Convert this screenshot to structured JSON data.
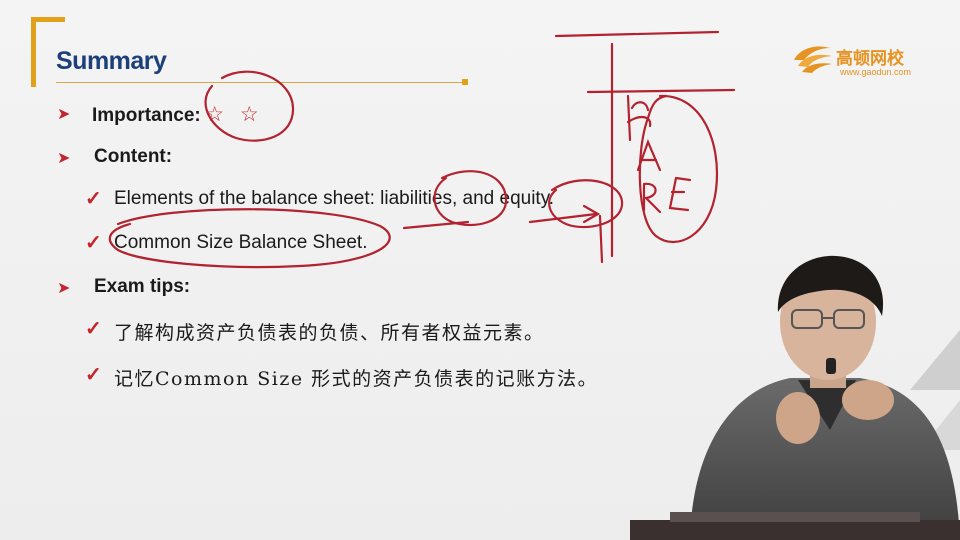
{
  "slide": {
    "title": "Summary",
    "logo": {
      "name": "高顿网校",
      "url": "www.gaodun.com"
    },
    "bullets": {
      "importance_label": "Importance:",
      "importance_stars": "☆ ☆",
      "content_label": "Content:",
      "content_items": [
        "Elements of the balance sheet: liabilities, and equity.",
        "Common Size Balance Sheet."
      ],
      "exam_label": "Exam tips:",
      "exam_items": [
        "了解构成资产负债表的负债、所有者权益元素。",
        "记忆Common Size 形式的资产负债表的记账方法。"
      ]
    },
    "annotation_letters": [
      "A",
      "E"
    ]
  },
  "icons": [
    "orange-bracket-icon",
    "gaodun-logo-icon",
    "arrow-bullet-icon",
    "check-bullet-icon",
    "star-icon"
  ],
  "colors": {
    "accent": "#e2a11b",
    "title": "#1d3f7a",
    "bullet": "#c5242b",
    "ink": "#b3232f"
  }
}
